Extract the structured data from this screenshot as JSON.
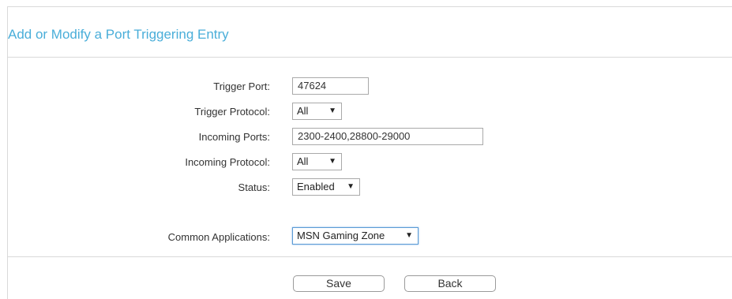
{
  "page": {
    "title": "Add or Modify a Port Triggering Entry"
  },
  "form": {
    "trigger_port": {
      "label": "Trigger Port:",
      "value": "47624"
    },
    "trigger_protocol": {
      "label": "Trigger Protocol:",
      "value": "All",
      "arrow": "▼"
    },
    "incoming_ports": {
      "label": "Incoming Ports:",
      "value": "2300-2400,28800-29000"
    },
    "incoming_protocol": {
      "label": "Incoming Protocol:",
      "value": "All",
      "arrow": "▼"
    },
    "status": {
      "label": "Status:",
      "value": "Enabled",
      "arrow": "▼"
    },
    "common_applications": {
      "label": "Common Applications:",
      "value": "MSN Gaming Zone",
      "arrow": "▼"
    }
  },
  "buttons": {
    "save": "Save",
    "back": "Back"
  },
  "colors": {
    "title": "#4aaed9",
    "border": "#d9d9d9",
    "focus_border": "#5b9bd5"
  },
  "icons": {
    "dropdown": "dropdown-arrow-icon"
  }
}
